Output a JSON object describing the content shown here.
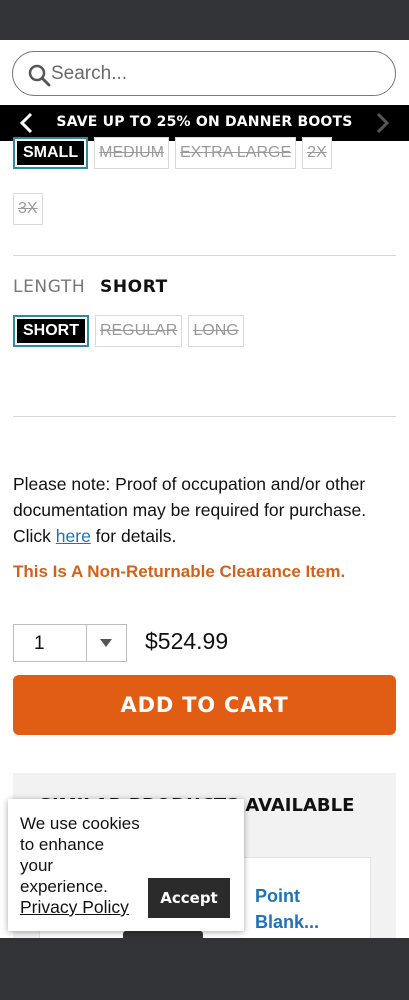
{
  "search": {
    "placeholder": "Search..."
  },
  "promo": {
    "text": "SAVE UP TO 25% ON DANNER BOOTS"
  },
  "size_options": [
    {
      "label": "SMALL"
    },
    {
      "label": "MEDIUM"
    },
    {
      "label": "EXTRA LARGE"
    },
    {
      "label": "2X"
    },
    {
      "label": "3X"
    }
  ],
  "length": {
    "label": "LENGTH",
    "selected_value": "SHORT",
    "options": [
      {
        "label": "SHORT"
      },
      {
        "label": "REGULAR"
      },
      {
        "label": "LONG"
      }
    ]
  },
  "note": {
    "text_before": "Please note: Proof of occupation and/or other documentation may be required for purchase. Click ",
    "link": "here",
    "text_after": " for details."
  },
  "non_returnable": "This Is A Non-Returnable Clearance Item.",
  "quantity": {
    "value": "1"
  },
  "price": "$524.99",
  "add_to_cart_label": "ADD TO CART",
  "similar": {
    "title": "SIMILAR PRODUCTS AVAILABLE",
    "product_name": "Point Blank..."
  },
  "cookie": {
    "message": "We use cookies to enhance your experience.",
    "policy_link": "Privacy Policy",
    "accept_label": "Accept"
  },
  "colors": {
    "accent_orange": "#e05d13",
    "selected_border": "#2c8aa3",
    "link_blue": "#1d72b8",
    "system_bar": "#323337"
  },
  "icons": {
    "search": "search-icon",
    "promo_prev": "chevron-left-icon",
    "promo_next": "chevron-right-icon",
    "quantity_dropdown": "caret-down-icon"
  }
}
